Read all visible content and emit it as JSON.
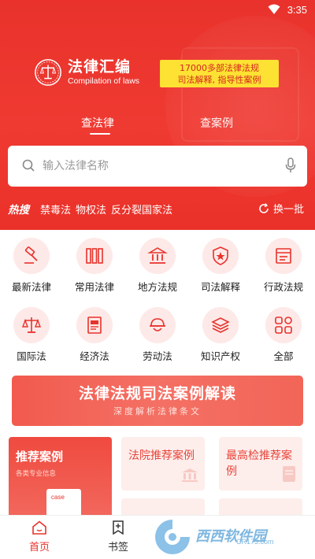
{
  "status_bar": {
    "time": "3:35"
  },
  "brand": {
    "title": "法律汇编",
    "subtitle": "Compilation of laws"
  },
  "promo": {
    "line1": "17000多部法律法规",
    "line2": "司法解释, 指导性案例"
  },
  "tabs": [
    {
      "label": "查法律",
      "active": true
    },
    {
      "label": "查案例",
      "active": false
    }
  ],
  "search": {
    "placeholder": "输入法律名称"
  },
  "hot": {
    "label": "热搜",
    "items": [
      "禁毒法",
      "物权法",
      "反分裂国家法"
    ],
    "refresh_label": "换一批"
  },
  "categories": [
    {
      "label": "最新法律",
      "icon": "gavel-icon"
    },
    {
      "label": "常用法律",
      "icon": "books-icon"
    },
    {
      "label": "地方法规",
      "icon": "courthouse-icon"
    },
    {
      "label": "司法解释",
      "icon": "badge-icon"
    },
    {
      "label": "行政法规",
      "icon": "folder-icon"
    },
    {
      "label": "国际法",
      "icon": "scales-icon"
    },
    {
      "label": "经济法",
      "icon": "ledger-icon"
    },
    {
      "label": "劳动法",
      "icon": "worker-icon"
    },
    {
      "label": "知识产权",
      "icon": "stack-icon"
    },
    {
      "label": "全部",
      "icon": "grid-icon"
    }
  ],
  "banner": {
    "title": "法律法规司法案例解读",
    "subtitle": "深度解析法律条文"
  },
  "cards": {
    "featured": {
      "title": "推荐案例",
      "subtitle": "各类专业信息",
      "doc_label": "case"
    },
    "items": [
      {
        "title": "法院推荐案例"
      },
      {
        "title": "最高检推荐案例"
      }
    ]
  },
  "bottom_nav": [
    {
      "label": "首页",
      "active": true
    },
    {
      "label": "书签",
      "active": false
    }
  ],
  "watermark": {
    "text": "西西软件园",
    "url": "CR173.com"
  },
  "colors": {
    "primary": "#e8322b",
    "promo_bg": "#fde133",
    "icon_bg": "#fde9e8"
  }
}
